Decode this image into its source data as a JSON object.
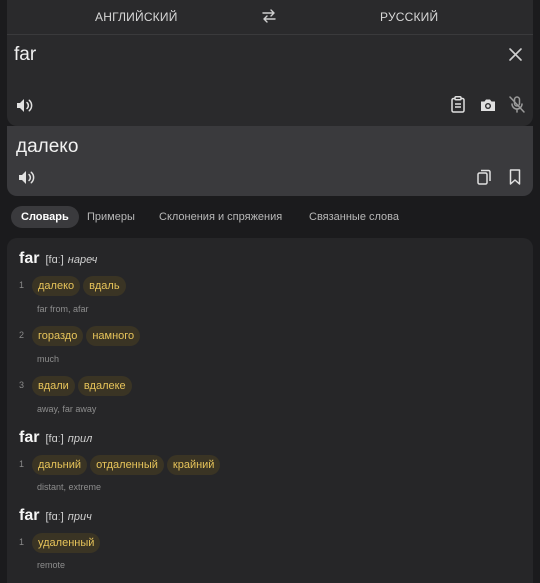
{
  "languages": {
    "source": "АНГЛИЙСКИЙ",
    "target": "РУССКИЙ"
  },
  "input": {
    "text": "far"
  },
  "output": {
    "text": "далеко"
  },
  "tabs": [
    "Словарь",
    "Примеры",
    "Склонения и спряжения",
    "Связанные слова"
  ],
  "active_tab": "Словарь",
  "dictionary": [
    {
      "word": "far",
      "transcription": "[fɑː]",
      "pos": "нареч",
      "senses": [
        {
          "num": "1",
          "translations": [
            "далеко",
            "вдаль"
          ],
          "gloss": "far from, afar"
        },
        {
          "num": "2",
          "translations": [
            "гораздо",
            "намного"
          ],
          "gloss": "much"
        },
        {
          "num": "3",
          "translations": [
            "вдали",
            "вдалеке"
          ],
          "gloss": "away, far away"
        }
      ]
    },
    {
      "word": "far",
      "transcription": "[fɑː]",
      "pos": "прил",
      "senses": [
        {
          "num": "1",
          "translations": [
            "дальний",
            "отдаленный",
            "крайний"
          ],
          "gloss": "distant, extreme"
        }
      ]
    },
    {
      "word": "far",
      "transcription": "[fɑː]",
      "pos": "прич",
      "senses": [
        {
          "num": "1",
          "translations": [
            "удаленный"
          ],
          "gloss": "remote"
        }
      ]
    }
  ],
  "colors": {
    "background": "#1b1b1d",
    "card": "#2a2a2c",
    "output_card": "#3a3a3d",
    "chip_bg": "#3a3424",
    "chip_text": "#e7c45a"
  },
  "icons": [
    "swap-icon",
    "clear-icon",
    "speaker-icon",
    "clipboard-icon",
    "camera-icon",
    "mic-off-icon",
    "copy-icon",
    "bookmark-icon"
  ]
}
